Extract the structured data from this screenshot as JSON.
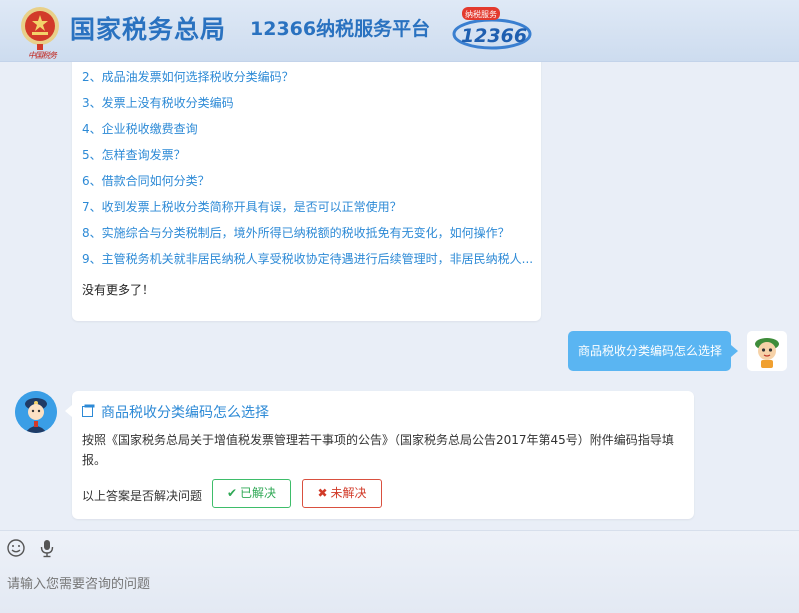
{
  "header": {
    "site_title": "国家税务总局",
    "platform_title": "12366纳税服务平台",
    "emblem_caption": "中国税务",
    "hotline_logo": {
      "banner": "纳税服务",
      "number": "12366"
    }
  },
  "colors": {
    "brand": "#2a72c0",
    "link": "#2d8ad6",
    "user_bubble": "#5ab5f2",
    "resolved": "#2fa855",
    "unresolved": "#d13a28"
  },
  "related_questions": [
    "2、成品油发票如何选择税收分类编码？",
    "3、发票上没有税收分类编码",
    "4、企业税收缴费查询",
    "5、怎样查询发票？",
    "6、借款合同如何分类？",
    "7、收到发票上税收分类简称开具有误，是否可以正常使用？",
    "8、实施综合与分类税制后，境外所得已纳税额的税收抵免有无变化，如何操作？",
    "9、主管税务机关就非居民纳税人享受税收协定待遇进行后续管理时，非居民纳税人..."
  ],
  "no_more_text": "没有更多了！",
  "user_message": "商品税收分类编码怎么选择",
  "answer": {
    "title_icon": "window-copy-icon",
    "title": "商品税收分类编码怎么选择",
    "body": "按照《国家税务总局关于增值税发票管理若干事项的公告》（国家税务总局公告2017年第45号）附件编码指导填报。",
    "resolve_question": "以上答案是否解决问题",
    "resolved_label": "已解决",
    "resolved_icon": "check-icon",
    "unresolved_label": "未解决",
    "unresolved_icon": "x-icon"
  },
  "input": {
    "tools": [
      "smiley-icon",
      "microphone-icon"
    ],
    "placeholder": "请输入您需要咨询的问题"
  }
}
